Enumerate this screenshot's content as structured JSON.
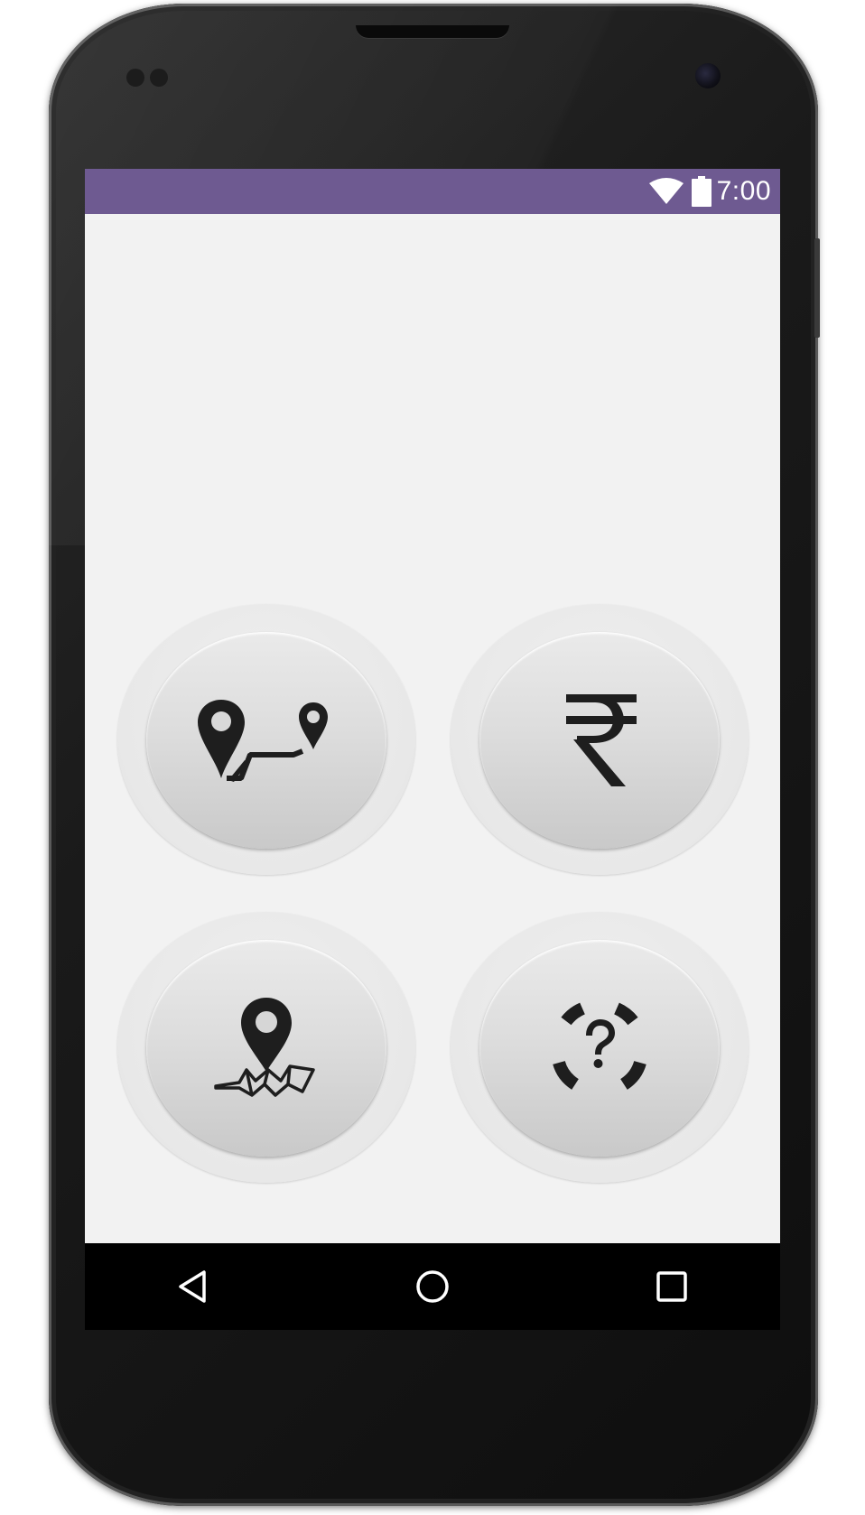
{
  "status_bar": {
    "time": "7:00",
    "color": "#6e5a91",
    "icons": [
      "wifi-icon",
      "battery-icon"
    ]
  },
  "main": {
    "buttons": [
      {
        "name": "route-button",
        "icon": "route-icon"
      },
      {
        "name": "fare-button",
        "icon": "rupee-icon"
      },
      {
        "name": "nearby-button",
        "icon": "map-pin-icon"
      },
      {
        "name": "help-button",
        "icon": "question-icon"
      }
    ]
  },
  "nav_bar": {
    "icons": [
      "back-icon",
      "home-icon",
      "recents-icon"
    ]
  }
}
